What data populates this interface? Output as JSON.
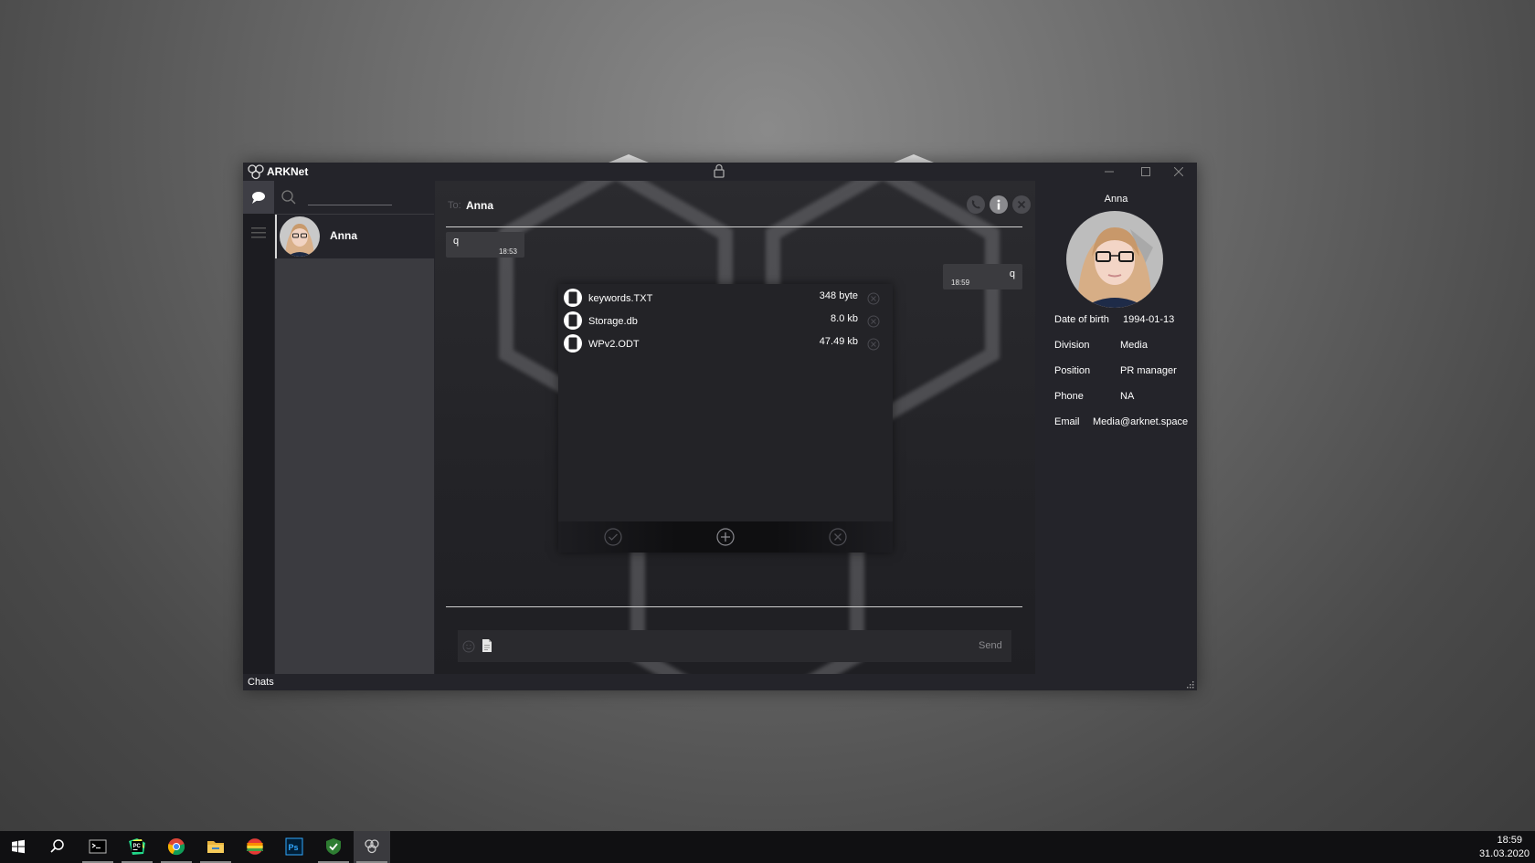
{
  "app": {
    "title": "ARKNet"
  },
  "sidebar": {
    "search_placeholder": ""
  },
  "contacts": [
    {
      "name": "Anna"
    }
  ],
  "chat": {
    "to_label": "To:",
    "to_name": "Anna",
    "messages": [
      {
        "text": "q",
        "time": "18:53",
        "direction": "incoming"
      },
      {
        "text": "q",
        "time": "18:59",
        "direction": "outgoing"
      }
    ],
    "compose_placeholder": "",
    "send_label": "Send"
  },
  "file_dialog": {
    "files": [
      {
        "name": "keywords.TXT",
        "size": "348 byte"
      },
      {
        "name": "Storage.db",
        "size": "8.0 kb"
      },
      {
        "name": "WPv2.ODT",
        "size": "47.49 kb"
      }
    ]
  },
  "profile": {
    "name": "Anna",
    "fields": [
      {
        "label": "Date of birth",
        "value": "1994-01-13"
      },
      {
        "label": "Division",
        "value": "Media"
      },
      {
        "label": "Position",
        "value": "PR manager"
      },
      {
        "label": "Phone",
        "value": "NA"
      },
      {
        "label": "Email",
        "value": "Media@arknet.space"
      }
    ]
  },
  "statusbar": {
    "text": "Chats"
  },
  "taskbar": {
    "time": "18:59",
    "date": "31.03.2020",
    "apps": [
      "windows-start-icon",
      "search-icon",
      "terminal-icon",
      "pycharm-icon",
      "chrome-icon",
      "file-explorer-icon",
      "colorful-app-icon",
      "photoshop-icon",
      "shield-icon",
      "arknet-icon"
    ]
  },
  "colors": {
    "window_bg": "#24242a",
    "contacts_bg": "#3b3b40",
    "message_bg": "#3b3b3f",
    "desktop": "#6d6d6d"
  }
}
